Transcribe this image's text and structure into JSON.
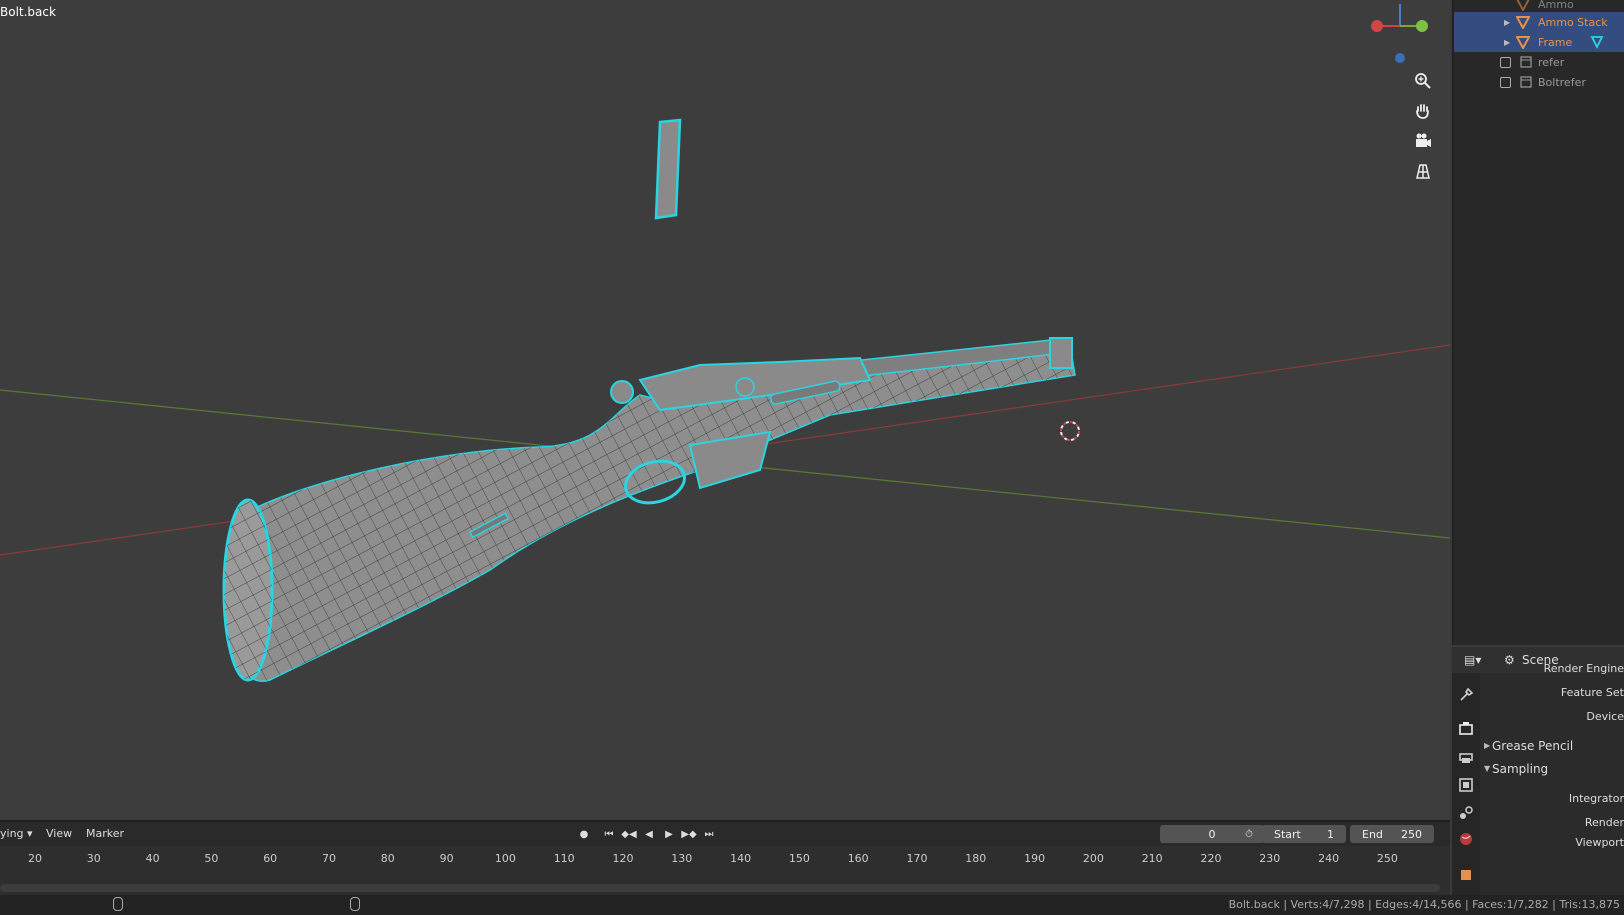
{
  "viewport": {
    "object_name": "Bolt.back",
    "nav_buttons": [
      "zoom-icon",
      "hand-icon",
      "camera-icon",
      "grid-icon"
    ]
  },
  "outliner": {
    "items": [
      {
        "label": "Ammo",
        "type": "mesh",
        "selected": false
      },
      {
        "label": "Ammo Stack",
        "type": "mesh",
        "selected": true
      },
      {
        "label": "Frame",
        "type": "mesh",
        "selected": true
      },
      {
        "label": "refer",
        "type": "collection",
        "selected": false
      },
      {
        "label": "Boltrefer",
        "type": "collection",
        "selected": false
      }
    ]
  },
  "properties": {
    "context": "Scene",
    "fields": [
      "Render Engine",
      "Feature Set",
      "Device"
    ],
    "panels": [
      {
        "label": "Grease Pencil",
        "expanded": false
      },
      {
        "label": "Sampling",
        "expanded": true
      }
    ],
    "sampling_fields": [
      "Integrator",
      "Render",
      "Viewport"
    ]
  },
  "timeline": {
    "mode": "ying",
    "menus": [
      "View",
      "Marker"
    ],
    "current_frame": "0",
    "start_label": "Start",
    "start_value": "1",
    "end_label": "End",
    "end_value": "250",
    "ticks": [
      "20",
      "30",
      "40",
      "50",
      "60",
      "70",
      "80",
      "90",
      "100",
      "110",
      "120",
      "130",
      "140",
      "150",
      "160",
      "170",
      "180",
      "190",
      "200",
      "210",
      "220",
      "230",
      "240",
      "250"
    ]
  },
  "statusbar": {
    "text": "Bolt.back | Verts:4/7,298 | Edges:4/14,566 | Faces:1/7,282 | Tris:13,875"
  },
  "colors": {
    "selection_outline": "#2ad4e0",
    "outliner_selected_bg": "#334d80",
    "active_object_text": "#e8904a"
  }
}
